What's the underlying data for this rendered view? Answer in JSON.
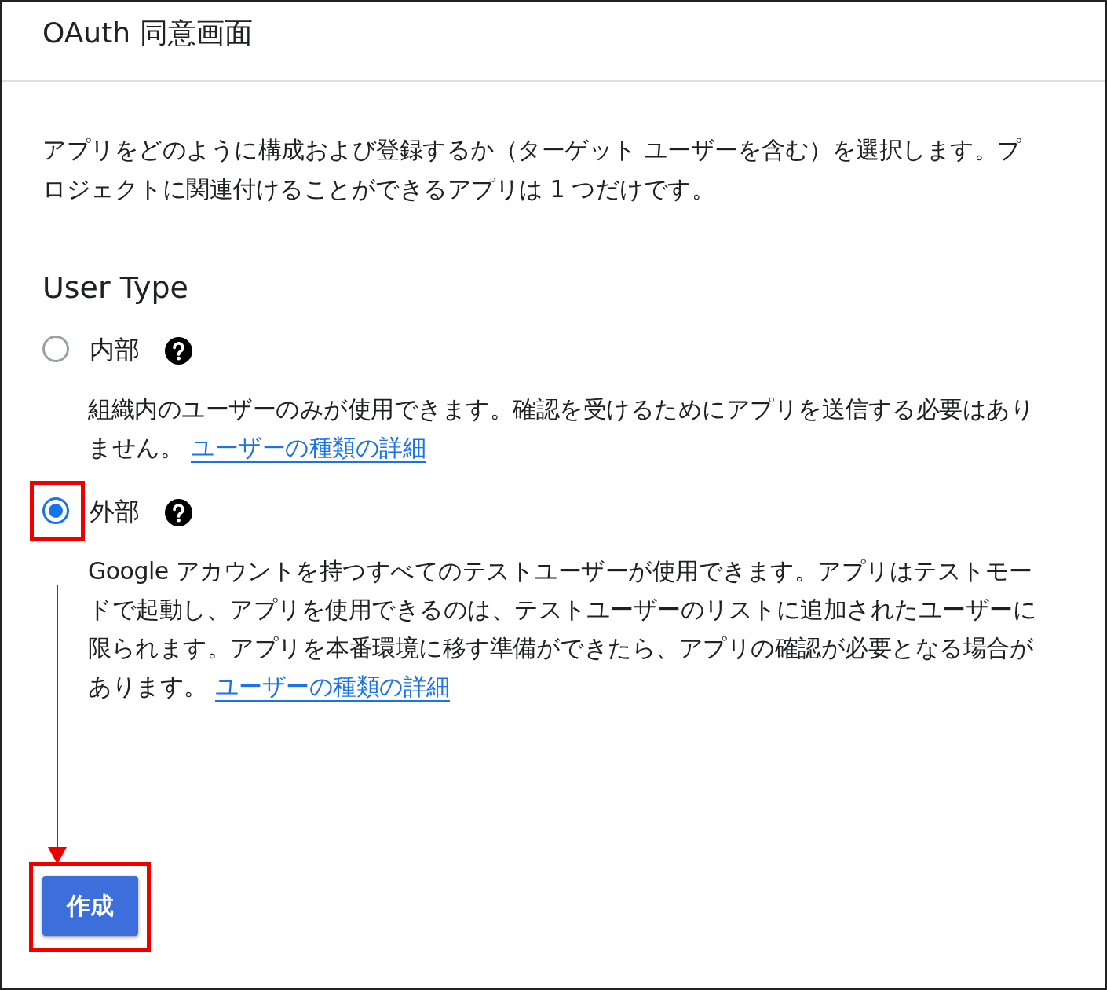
{
  "header": {
    "title": "OAuth 同意画面"
  },
  "intro": "アプリをどのように構成および登録するか（ターゲット ユーザーを含む）を選択します。プロジェクトに関連付けることができるアプリは 1 つだけです。",
  "user_type": {
    "heading": "User Type",
    "options": [
      {
        "label": "内部",
        "selected": false,
        "description": "組織内のユーザーのみが使用できます。確認を受けるためにアプリを送信する必要はありません。",
        "link": "ユーザーの種類の詳細"
      },
      {
        "label": "外部",
        "selected": true,
        "description": "Google アカウントを持つすべてのテストユーザーが使用できます。アプリはテストモードで起動し、アプリを使用できるのは、テストユーザーのリストに追加されたユーザーに限られます。アプリを本番環境に移す準備ができたら、アプリの確認が必要となる場合があります。",
        "link": "ユーザーの種類の詳細"
      }
    ]
  },
  "create_button": "作成"
}
